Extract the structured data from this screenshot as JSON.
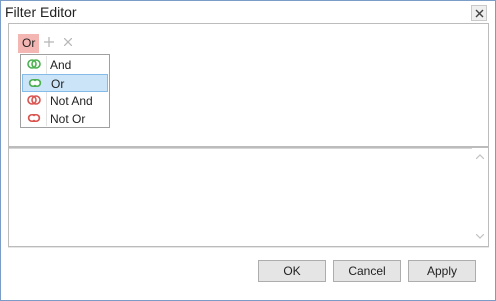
{
  "window": {
    "title": "Filter Editor"
  },
  "editor": {
    "group_operator": "Or",
    "operator_menu": [
      {
        "label": "And",
        "icon": "and-group-icon",
        "color": "#4caf50"
      },
      {
        "label": "Or",
        "icon": "or-group-icon",
        "color": "#4caf50",
        "selected": true
      },
      {
        "label": "Not And",
        "icon": "not-and-group-icon",
        "color": "#d9534f"
      },
      {
        "label": "Not Or",
        "icon": "not-or-group-icon",
        "color": "#d9534f"
      }
    ]
  },
  "buttons": {
    "ok": "OK",
    "cancel": "Cancel",
    "apply": "Apply"
  },
  "colors": {
    "group_node_bg": "#f4b6b3",
    "selection_bg": "#cce4f7",
    "window_border": "#7a9cc6"
  }
}
